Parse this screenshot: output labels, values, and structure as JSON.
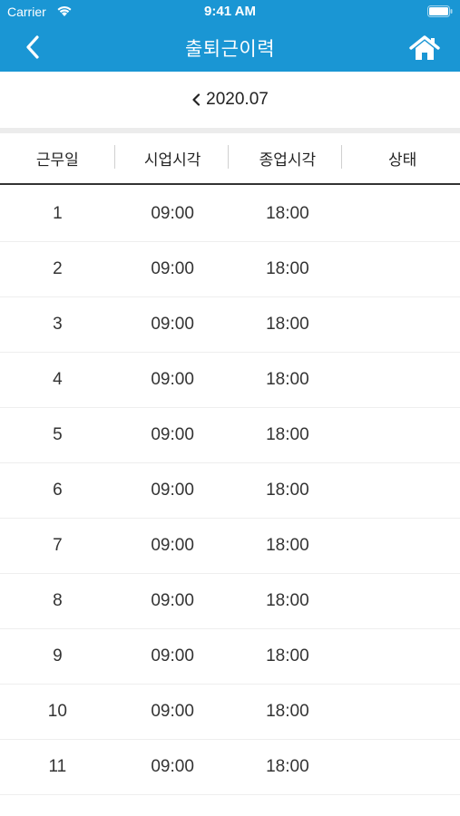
{
  "status_bar": {
    "carrier": "Carrier",
    "time": "9:41 AM",
    "wifi_icon": "wifi-icon",
    "battery_icon": "battery-icon"
  },
  "nav": {
    "title": "출퇴근이력",
    "back_icon": "chevron-left-icon",
    "home_icon": "home-icon",
    "color": "#1a96d4"
  },
  "month": {
    "prev_icon": "chevron-left-icon",
    "label": "2020.07"
  },
  "table": {
    "columns": [
      "근무일",
      "시업시각",
      "종업시각",
      "상태"
    ],
    "rows": [
      {
        "day": "1",
        "start": "09:00",
        "end": "18:00",
        "status": ""
      },
      {
        "day": "2",
        "start": "09:00",
        "end": "18:00",
        "status": ""
      },
      {
        "day": "3",
        "start": "09:00",
        "end": "18:00",
        "status": ""
      },
      {
        "day": "4",
        "start": "09:00",
        "end": "18:00",
        "status": ""
      },
      {
        "day": "5",
        "start": "09:00",
        "end": "18:00",
        "status": ""
      },
      {
        "day": "6",
        "start": "09:00",
        "end": "18:00",
        "status": ""
      },
      {
        "day": "7",
        "start": "09:00",
        "end": "18:00",
        "status": ""
      },
      {
        "day": "8",
        "start": "09:00",
        "end": "18:00",
        "status": ""
      },
      {
        "day": "9",
        "start": "09:00",
        "end": "18:00",
        "status": ""
      },
      {
        "day": "10",
        "start": "09:00",
        "end": "18:00",
        "status": ""
      },
      {
        "day": "11",
        "start": "09:00",
        "end": "18:00",
        "status": ""
      }
    ]
  }
}
